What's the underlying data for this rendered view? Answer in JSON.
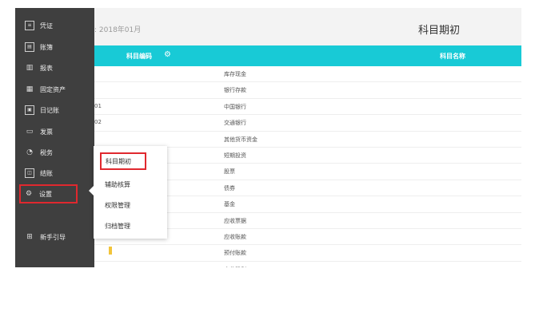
{
  "sidebar": {
    "items": [
      {
        "label": "凭证",
        "icon": "voucher-icon"
      },
      {
        "label": "账簿",
        "icon": "ledger-icon"
      },
      {
        "label": "报表",
        "icon": "chart-icon"
      },
      {
        "label": "固定资产",
        "icon": "building-icon"
      },
      {
        "label": "日记账",
        "icon": "journal-icon"
      },
      {
        "label": "发票",
        "icon": "invoice-icon"
      },
      {
        "label": "税务",
        "icon": "tax-icon"
      },
      {
        "label": "结账",
        "icon": "close-books-icon"
      },
      {
        "label": "设置",
        "icon": "gear-icon"
      }
    ],
    "guide_label": "新手引导"
  },
  "header": {
    "period": ": 2018年01月",
    "title": "科目期初"
  },
  "table": {
    "col_code": "科目编码",
    "col_name": "科目名称",
    "rows": [
      {
        "code": "",
        "name": "库存现金"
      },
      {
        "code": "",
        "name": "银行存款"
      },
      {
        "code": "01",
        "name": "中国银行"
      },
      {
        "code": "02",
        "name": "交通银行"
      },
      {
        "code": "",
        "name": "其他货币资金"
      },
      {
        "code": "",
        "name": "短期投资"
      },
      {
        "code": "",
        "name": "股票"
      },
      {
        "code": "",
        "name": "债券"
      },
      {
        "code": "",
        "name": "基金"
      },
      {
        "code": "",
        "name": "应收票据"
      },
      {
        "code": "",
        "name": "应收账款"
      },
      {
        "code": "",
        "name": "预付账款"
      },
      {
        "code": "",
        "name": "应收股利"
      }
    ]
  },
  "popup": {
    "items": [
      "科目期初",
      "辅助核算",
      "权限管理",
      "归档管理"
    ]
  },
  "colors": {
    "sidebar_bg": "#3f3f3f",
    "header_bg": "#18cad6",
    "highlight": "#e0282e"
  }
}
